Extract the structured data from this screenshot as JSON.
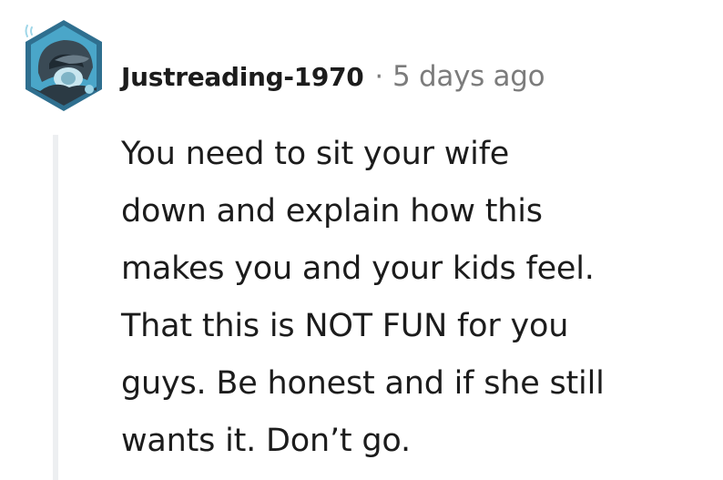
{
  "comment": {
    "username": "Justreading-1970",
    "separator": "·",
    "timestamp": "5 days ago",
    "body_lines": [
      "You need to sit your wife",
      "down and explain how this",
      "makes you and your kids feel.",
      "That this is NOT FUN for you",
      "guys. Be honest and if she still",
      "wants it. Don’t go."
    ]
  },
  "colors": {
    "text": "#1c1c1c",
    "meta": "#7c7c7c",
    "thread_line": "#edeff1",
    "avatar_accent": "#5ab8d8"
  }
}
